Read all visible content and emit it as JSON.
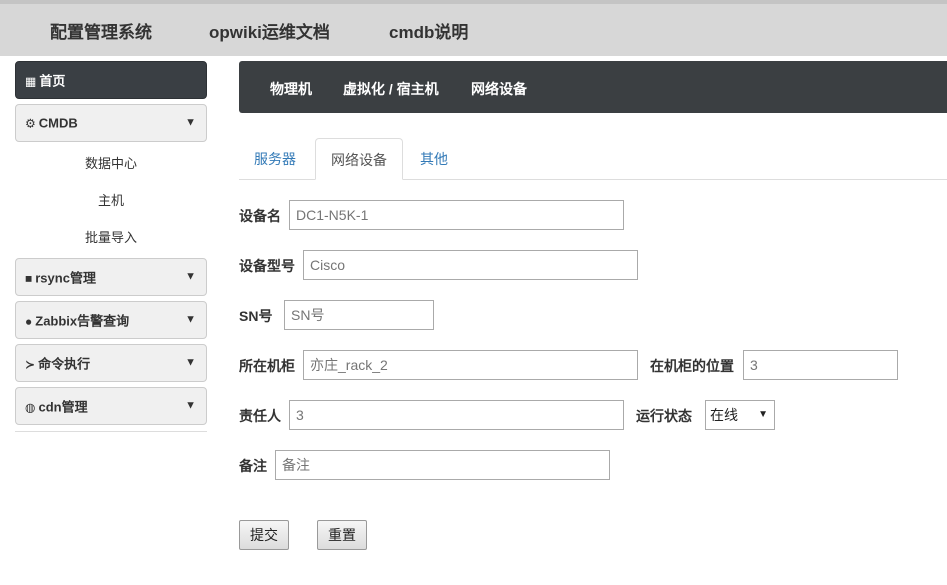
{
  "topbar": {
    "items": [
      "配置管理系统",
      "opwiki运维文档",
      "cmdb说明"
    ]
  },
  "sidebar": {
    "home": {
      "label": "首页",
      "icon": "grid-icon"
    },
    "cmdb": {
      "label": "CMDB",
      "icon": "gear-icon",
      "subitems": [
        "数据中心",
        "主机",
        "批量导入"
      ]
    },
    "rsync": {
      "label": "rsync管理",
      "icon": "folder-icon"
    },
    "zabbix": {
      "label": "Zabbix告警查询",
      "icon": "alert-icon"
    },
    "command": {
      "label": "命令执行",
      "icon": "terminal-icon"
    },
    "cdn": {
      "label": "cdn管理",
      "icon": "globe-icon"
    }
  },
  "darkbar": {
    "items": [
      "物理机",
      "虚拟化 / 宿主机",
      "网络设备"
    ]
  },
  "tabs": {
    "items": [
      "服务器",
      "网络设备",
      "其他"
    ],
    "active": "网络设备"
  },
  "form": {
    "device_name": {
      "label": "设备名",
      "placeholder": "DC1-N5K-1"
    },
    "device_model": {
      "label": "设备型号",
      "placeholder": "Cisco"
    },
    "sn": {
      "label": "SN号",
      "placeholder": "SN号"
    },
    "rack": {
      "label": "所在机柜",
      "placeholder": "亦庄_rack_2"
    },
    "rack_position": {
      "label": "在机柜的位置",
      "placeholder": "3"
    },
    "owner": {
      "label": "责任人",
      "placeholder": "3"
    },
    "status": {
      "label": "运行状态",
      "value": "在线"
    },
    "remark": {
      "label": "备注",
      "placeholder": "备注"
    },
    "submit_label": "提交",
    "reset_label": "重置"
  }
}
